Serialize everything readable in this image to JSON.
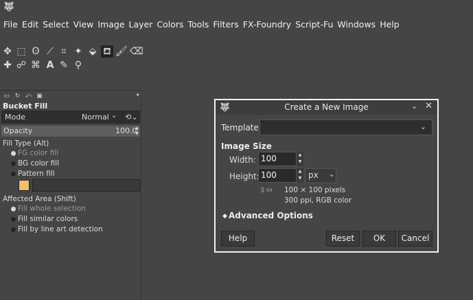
{
  "menubar": {
    "items": [
      "File",
      "Edit",
      "Select",
      "View",
      "Image",
      "Layer",
      "Colors",
      "Tools",
      "Filters",
      "FX-Foundry",
      "Script-Fu",
      "Windows",
      "Help"
    ]
  },
  "toolbox": {
    "tools_row1": [
      "move-icon",
      "rect-select-icon",
      "lasso-icon",
      "fuzzy-select-icon",
      "crop-icon",
      "warp-icon",
      "transform-icon",
      "bucket-fill-icon",
      "paintbrush-icon",
      "eraser-icon"
    ],
    "tools_row2": [
      "heal-icon",
      "smudge-icon",
      "path-icon",
      "text-icon",
      "color-picker-icon",
      "zoom-icon"
    ],
    "fg_color": "#5ee155",
    "bg_color": "#e24235"
  },
  "tool_options": {
    "title": "Bucket Fill",
    "mode_label": "Mode",
    "mode_value": "Normal",
    "opacity_label": "Opacity",
    "opacity_value": "100.0",
    "fill_type_label": "Fill Type  (Alt)",
    "fill_types": [
      "FG color fill",
      "BG color fill",
      "Pattern fill"
    ],
    "fill_type_selected": 0,
    "affected_area_label": "Affected Area  (Shift)",
    "affected_areas": [
      "Fill whole selection",
      "Fill similar colors",
      "Fill by line art detection"
    ],
    "affected_area_selected": 0,
    "pattern_color": "#f4bf6b"
  },
  "dialog": {
    "title": "Create a New Image",
    "template_label": "Template:",
    "template_value": "",
    "image_size_label": "Image Size",
    "width_label": "Width:",
    "width_value": "100",
    "height_label": "Height:",
    "height_value": "100",
    "unit_value": "px",
    "dimensions_text": "100 × 100 pixels",
    "resolution_text": "300 ppi, RGB color",
    "advanced_label": "Advanced Options",
    "help_label": "Help",
    "reset_label": "Reset",
    "ok_label": "OK",
    "cancel_label": "Cancel"
  }
}
